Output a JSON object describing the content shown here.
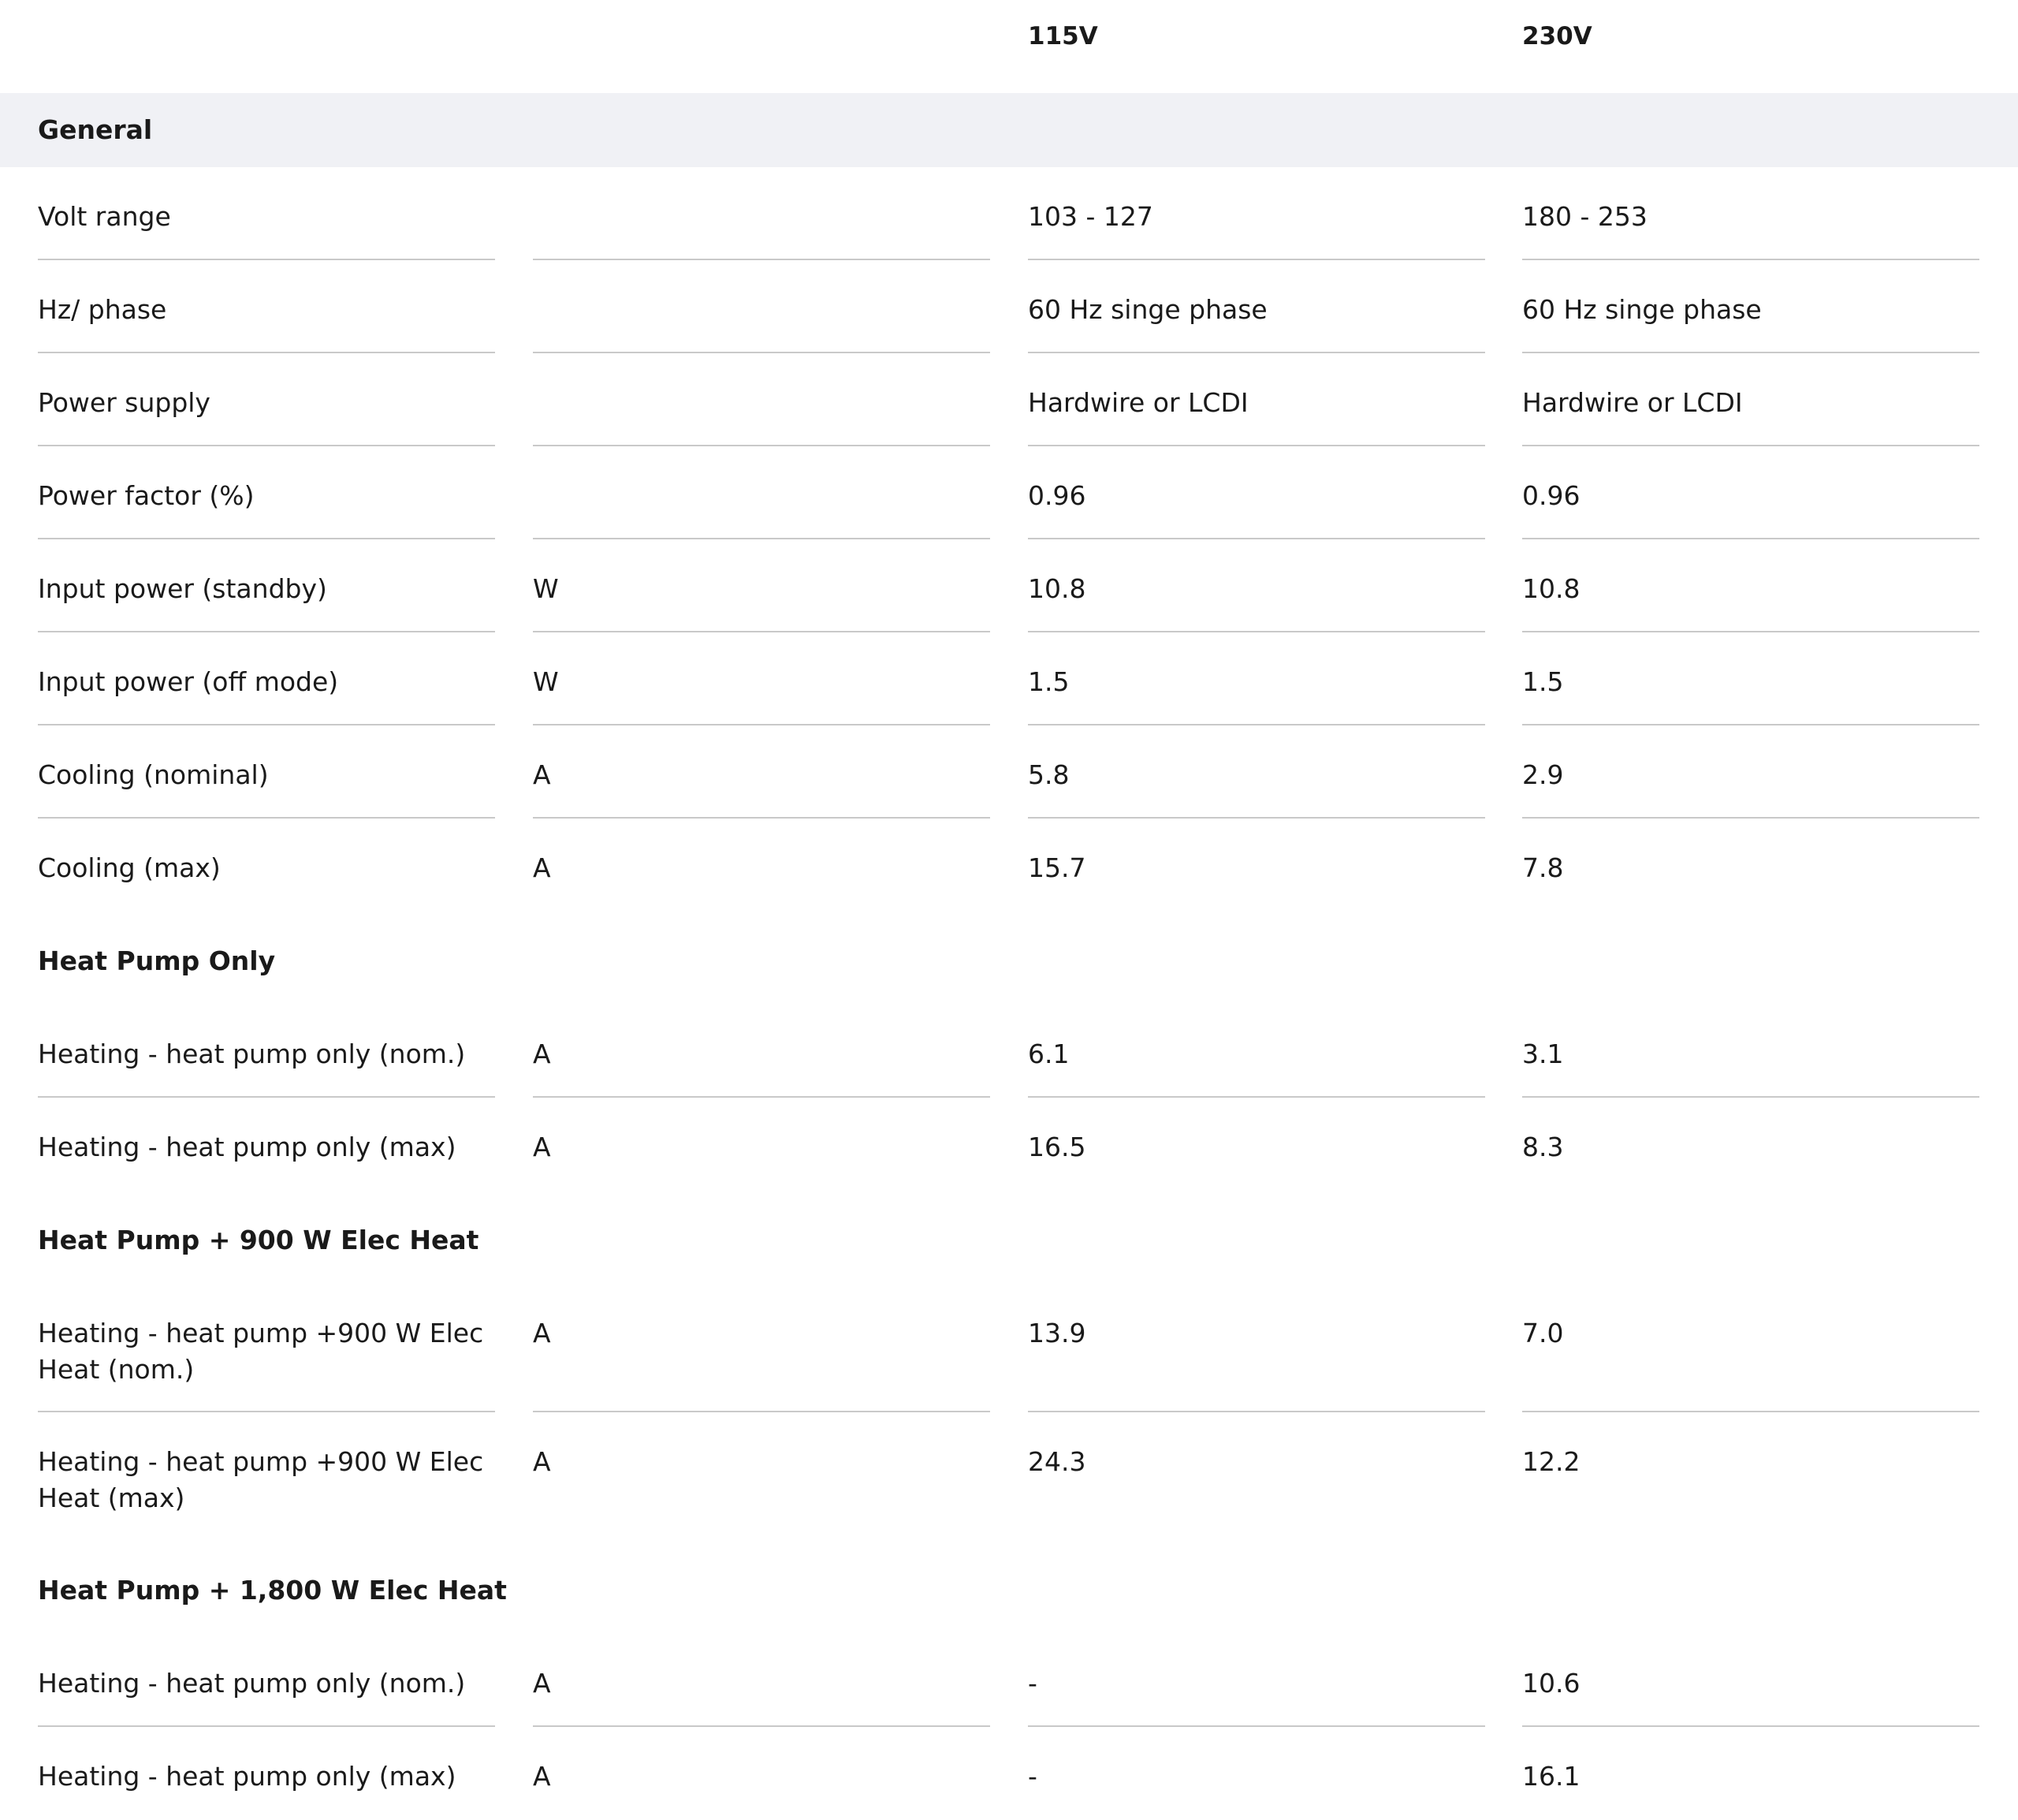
{
  "header": {
    "col_115": "115V",
    "col_230": "230V"
  },
  "section": {
    "title": "General"
  },
  "rows_general": [
    {
      "label": "Volt range",
      "unit": "",
      "v115": "103 - 127",
      "v230": "180 - 253"
    },
    {
      "label": "Hz/ phase",
      "unit": "",
      "v115": "60 Hz singe phase",
      "v230": "60 Hz singe phase"
    },
    {
      "label": "Power supply",
      "unit": "",
      "v115": "Hardwire or LCDI",
      "v230": "Hardwire or LCDI"
    },
    {
      "label": "Power factor (%)",
      "unit": "",
      "v115": "0.96",
      "v230": "0.96"
    },
    {
      "label": "Input power (standby)",
      "unit": "W",
      "v115": "10.8",
      "v230": "10.8"
    },
    {
      "label": "Input power (off mode)",
      "unit": "W",
      "v115": "1.5",
      "v230": "1.5"
    },
    {
      "label": "Cooling (nominal)",
      "unit": "A",
      "v115": "5.8",
      "v230": "2.9"
    },
    {
      "label": "Cooling (max)",
      "unit": "A",
      "v115": "15.7",
      "v230": "7.8"
    }
  ],
  "group_hp_only": {
    "title": "Heat Pump Only",
    "rows": [
      {
        "label": "Heating - heat pump only (nom.)",
        "unit": "A",
        "v115": "6.1",
        "v230": "3.1"
      },
      {
        "label": "Heating - heat pump only (max)",
        "unit": "A",
        "v115": "16.5",
        "v230": "8.3"
      }
    ]
  },
  "group_hp_900": {
    "title": "Heat Pump + 900 W Elec Heat",
    "rows": [
      {
        "label": "Heating - heat pump +900 W Elec Heat (nom.)",
        "unit": "A",
        "v115": "13.9",
        "v230": "7.0"
      },
      {
        "label": "Heating - heat pump +900 W Elec Heat (max)",
        "unit": "A",
        "v115": "24.3",
        "v230": "12.2"
      }
    ]
  },
  "group_hp_1800": {
    "title": "Heat Pump + 1,800 W Elec Heat",
    "rows": [
      {
        "label": "Heating - heat pump only (nom.)",
        "unit": "A",
        "v115": "-",
        "v230": "10.6"
      },
      {
        "label": "Heating - heat pump only (max)",
        "unit": "A",
        "v115": "-",
        "v230": "16.1"
      }
    ]
  }
}
